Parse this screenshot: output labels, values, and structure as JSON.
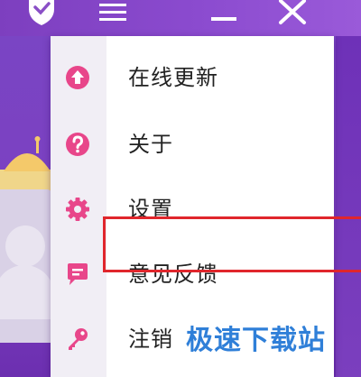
{
  "colors": {
    "accent_purple": "#8a4fc6",
    "menu_icon_pink": "#e8468a",
    "highlight_red": "#e0262c",
    "watermark_blue": "#2f7fd8"
  },
  "titlebar": {
    "icons": [
      "shield-icon",
      "hamburger-menu-icon",
      "minimize-icon",
      "close-icon"
    ]
  },
  "menu": {
    "items": [
      {
        "label": "在线更新",
        "icon": "upload-arrow-icon"
      },
      {
        "label": "关于",
        "icon": "help-question-icon"
      },
      {
        "label": "设置",
        "icon": "gear-icon",
        "highlighted": true
      },
      {
        "label": "意见反馈",
        "icon": "chat-bubble-icon"
      },
      {
        "label": "注销",
        "icon": "key-icon"
      }
    ]
  },
  "watermark": {
    "text": "极速下载站"
  }
}
